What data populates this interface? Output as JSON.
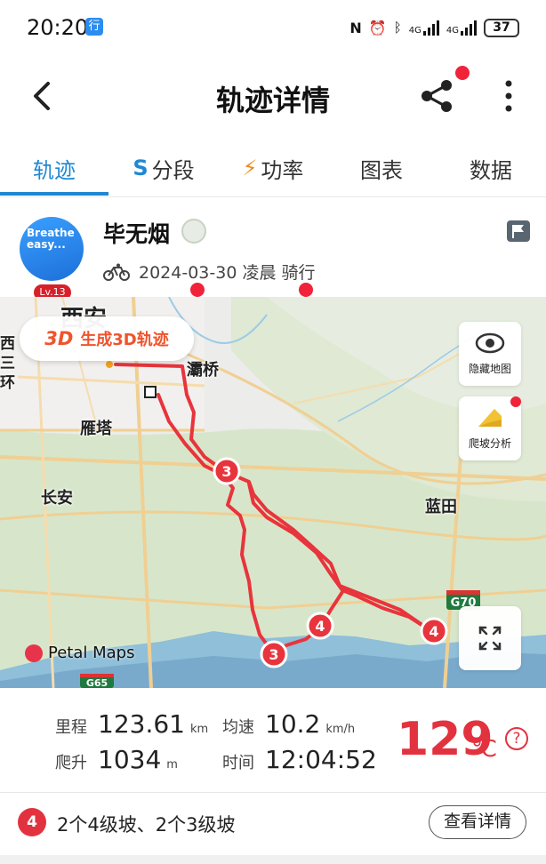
{
  "status_bar": {
    "time": "20:20",
    "tag": "行",
    "signal_label": "4G",
    "signal_label_2": "4G",
    "battery": "37"
  },
  "nav": {
    "title": "轨迹详情"
  },
  "tabs": [
    {
      "label": "轨迹",
      "icon": "",
      "active": true
    },
    {
      "label": "分段",
      "icon": "S",
      "active": false
    },
    {
      "label": "功率",
      "icon": "⚡",
      "active": false
    },
    {
      "label": "图表",
      "icon": "",
      "active": false
    },
    {
      "label": "数据",
      "icon": "",
      "active": false
    }
  ],
  "user": {
    "avatar_text": "Breathe easy...",
    "level": "Lv.13",
    "name": "毕无烟",
    "meta": "2024-03-30 凌晨 骑行"
  },
  "map": {
    "generate_3d": "生成3D轨迹",
    "generate_3d_prefix": "3D",
    "hide_map": "隐藏地图",
    "climb_analysis": "爬坡分析",
    "labels": {
      "xian": "西安",
      "baqiao": "灞桥",
      "yanta": "雁塔",
      "changan": "长安",
      "lantian": "蓝田",
      "left_chars": "西三环"
    },
    "road_g70": "G70",
    "road_g65": "G65",
    "climb_markers": [
      "3",
      "4",
      "3",
      "4"
    ],
    "attribution": "Petal Maps",
    "colors": {
      "route": "#e8343c",
      "water": "#7fb7d8",
      "green": "#cfe2c1"
    }
  },
  "stats": {
    "distance_label": "里程",
    "distance_value": "123.61",
    "distance_unit": "km",
    "avg_speed_label": "均速",
    "avg_speed_value": "10.2",
    "avg_speed_unit": "km/h",
    "climb_label": "爬升",
    "climb_value": "1034",
    "climb_unit": "m",
    "time_label": "时间",
    "time_value": "12:04:52",
    "temp_value": "129",
    "temp_unit": "℃",
    "help": "?"
  },
  "climbs": {
    "badge": "4",
    "text": "2个4级坡、2个3级坡",
    "details_button": "查看详情"
  }
}
